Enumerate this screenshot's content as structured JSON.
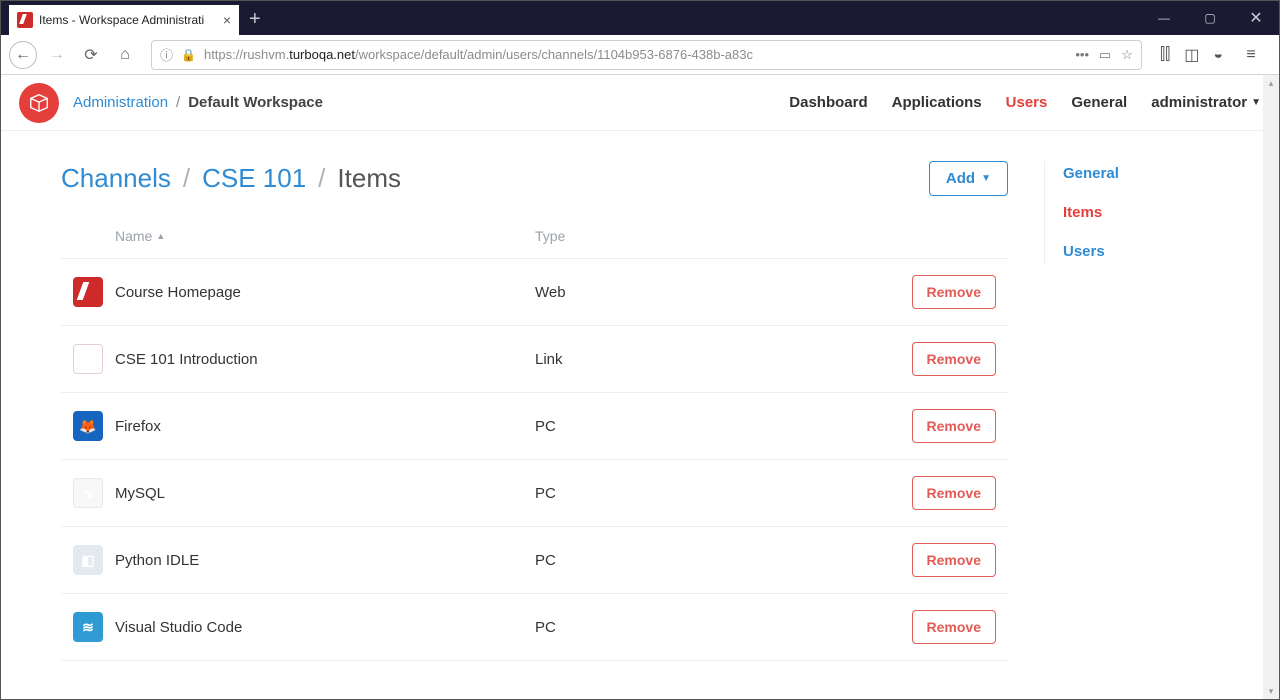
{
  "browser": {
    "tab_title": "Items - Workspace Administrati",
    "url_prefix": "https://rushvm.",
    "url_host": "turboqa.net",
    "url_path": "/workspace/default/admin/users/channels/1104b953-6876-438b-a83c"
  },
  "topnav": {
    "breadcrumb_root": "Administration",
    "breadcrumb_workspace": "Default Workspace",
    "links": {
      "dashboard": "Dashboard",
      "applications": "Applications",
      "users": "Users",
      "general": "General",
      "account": "administrator"
    }
  },
  "page": {
    "crumb_channels": "Channels",
    "crumb_channel": "CSE 101",
    "crumb_items": "Items",
    "add_button": "Add"
  },
  "columns": {
    "name": "Name",
    "type": "Type"
  },
  "rows": [
    {
      "icon": "ic-red",
      "name": "Course Homepage",
      "type": "Web",
      "remove": "Remove"
    },
    {
      "icon": "ic-pdf",
      "name": "CSE 101 Introduction",
      "type": "Link",
      "remove": "Remove"
    },
    {
      "icon": "ic-ff",
      "name": "Firefox",
      "type": "PC",
      "remove": "Remove"
    },
    {
      "icon": "ic-mysql",
      "name": "MySQL",
      "type": "PC",
      "remove": "Remove"
    },
    {
      "icon": "ic-py",
      "name": "Python IDLE",
      "type": "PC",
      "remove": "Remove"
    },
    {
      "icon": "ic-vsc",
      "name": "Visual Studio Code",
      "type": "PC",
      "remove": "Remove"
    }
  ],
  "side": {
    "general": "General",
    "items": "Items",
    "users": "Users"
  }
}
